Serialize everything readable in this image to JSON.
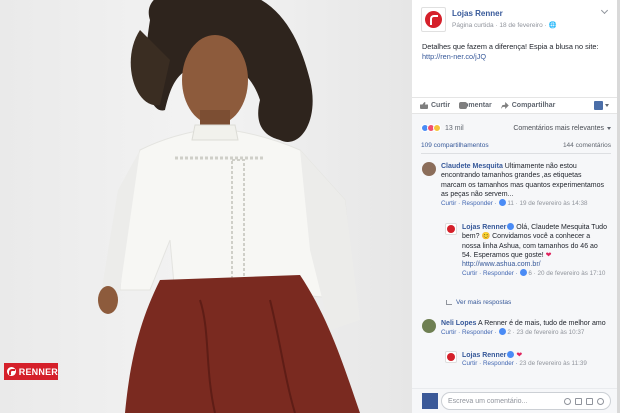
{
  "brand_badge": "RENNER",
  "post": {
    "page_name": "Lojas Renner",
    "meta": "Página curtida · 18 de fevereiro · 🌐",
    "text": "Detalhes que fazem a diferença! Espia a blusa no site: ",
    "link": "http://ren-ner.co/jJQ"
  },
  "actions": {
    "like": "Curtir",
    "comment": "Comentar",
    "share": "Compartilhar"
  },
  "reactions": {
    "count": "13 mil",
    "sort_label": "Comentários mais relevantes"
  },
  "stats": {
    "shares": "109 compartilhamentos",
    "comments": "144 comentários"
  },
  "comments": [
    {
      "author": "Claudete Mesquita",
      "text": " Ultimamente não estou encontrando tamanhos grandes ,as etiquetas marcam os tamanhos mas quantos experimentamos as peças não servem...",
      "meta_actions": "Curtir · Responder · ",
      "likes": "11",
      "time": " · 19 de fevereiro às 14:38"
    },
    {
      "author": "Lojas Renner",
      "text": " Olá, Claudete Mesquita Tudo bem? 😊 Convidamos você a conhecer a nossa linha Ashua, com tamanhos do 46 ao 54. Esperamos que goste! ",
      "link": "http://www.ashua.com.br/",
      "meta_actions": "Curtir · Responder · ",
      "likes": "6",
      "time": " · 20 de fevereiro às 17:10"
    },
    {
      "author": "Neli Lopes",
      "text": " A Renner é de mais, tudo de melhor amo",
      "meta_actions": "Curtir · Responder · ",
      "likes": "2",
      "time": " · 23 de fevereiro às 10:37"
    },
    {
      "author": "Lojas Renner",
      "text": " ",
      "meta_actions": "Curtir · Responder · ",
      "likes": "",
      "time": "23 de fevereiro às 11:39"
    }
  ],
  "more_replies": "Ver mais respostas",
  "composer_placeholder": "Escreva um comentário...",
  "colors": {
    "brand": "#d5202a",
    "fb_link": "#365899",
    "reaction_like": "#4a8bf5",
    "reaction_love": "#f0506e"
  }
}
